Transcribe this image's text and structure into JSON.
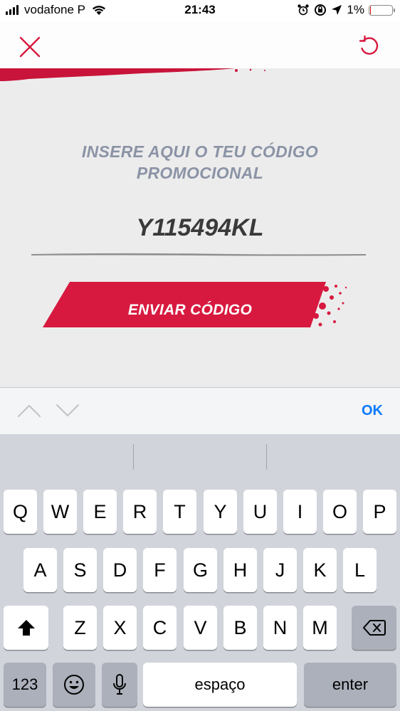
{
  "status_bar": {
    "carrier": "vodafone P",
    "time": "21:43",
    "battery_percent": "1%",
    "battery_level": 0.01,
    "icons": [
      "signal-icon",
      "wifi-icon",
      "alarm-icon",
      "orientation-lock-icon",
      "location-arrow-icon",
      "battery-icon"
    ]
  },
  "header": {
    "close_icon": "close-icon",
    "reset_icon": "reset-icon",
    "accent_color": "#d7193f"
  },
  "promo": {
    "title": "INSERE AQUI O TEU CÓDIGO PROMOCIONAL",
    "code_value": "Y115494KL",
    "send_button_label": "ENVIAR CÓDIGO",
    "button_color": "#d7193f"
  },
  "accessory_bar": {
    "prev_icon": "chevron-up-icon",
    "next_icon": "chevron-down-icon",
    "ok_label": "OK"
  },
  "keyboard": {
    "row1": [
      "Q",
      "W",
      "E",
      "R",
      "T",
      "Y",
      "U",
      "I",
      "O",
      "P"
    ],
    "row2": [
      "A",
      "S",
      "D",
      "F",
      "G",
      "H",
      "J",
      "K",
      "L"
    ],
    "row3": [
      "Z",
      "X",
      "C",
      "V",
      "B",
      "N",
      "M"
    ],
    "numbers_label": "123",
    "space_label": "espaço",
    "enter_label": "enter",
    "shift_icon": "shift-icon",
    "backspace_icon": "backspace-icon",
    "emoji_icon": "emoji-icon",
    "mic_icon": "microphone-icon"
  }
}
